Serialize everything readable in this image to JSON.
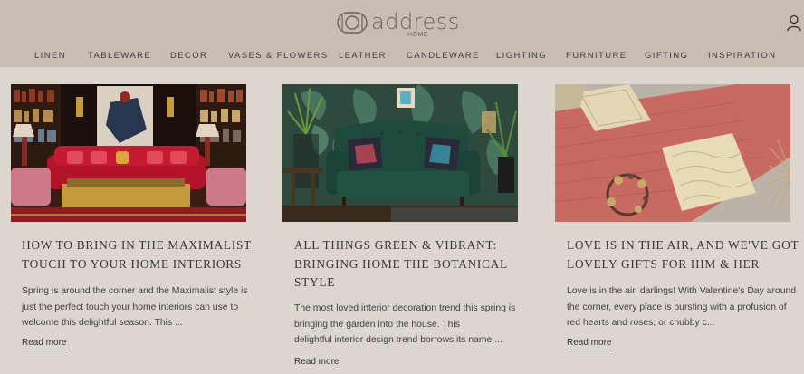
{
  "header": {
    "logo_text": "address",
    "logo_sub": "HOME",
    "nav": [
      "LINEN",
      "TABLEWARE",
      "DECOR",
      "VASES & FLOWERS",
      "LEATHER",
      "CANDLEWARE",
      "LIGHTING",
      "FURNITURE",
      "GIFTING",
      "INSPIRATION"
    ]
  },
  "articles": [
    {
      "title_lines": [
        "HOW TO BRING IN THE MAXIMALIST",
        "TOUCH TO YOUR HOME INTERIORS"
      ],
      "excerpt_lines": [
        "Spring is around the corner and the Maximalist style is",
        "just the perfect touch your home interiors can use to",
        "welcome this delightful season. This ..."
      ],
      "read_more": "Read more"
    },
    {
      "title_lines": [
        "ALL THINGS GREEN & VIBRANT:",
        "BRINGING HOME THE BOTANICAL",
        "STYLE"
      ],
      "excerpt_lines": [
        "The most loved interior decoration trend this spring is",
        "bringing the garden into the house. This",
        "delightful interior design trend borrows its name ..."
      ],
      "read_more": "Read more"
    },
    {
      "title_lines": [
        "LOVE IS IN THE AIR, AND WE'VE GOT",
        "LOVELY GIFTS FOR HIM & HER"
      ],
      "excerpt_lines": [
        "Love is in the air, darlings! With Valentine's Day around",
        "the corner, every place is bursting with a profusion of",
        "red hearts and roses, or chubby c..."
      ],
      "read_more": "Read more"
    }
  ]
}
